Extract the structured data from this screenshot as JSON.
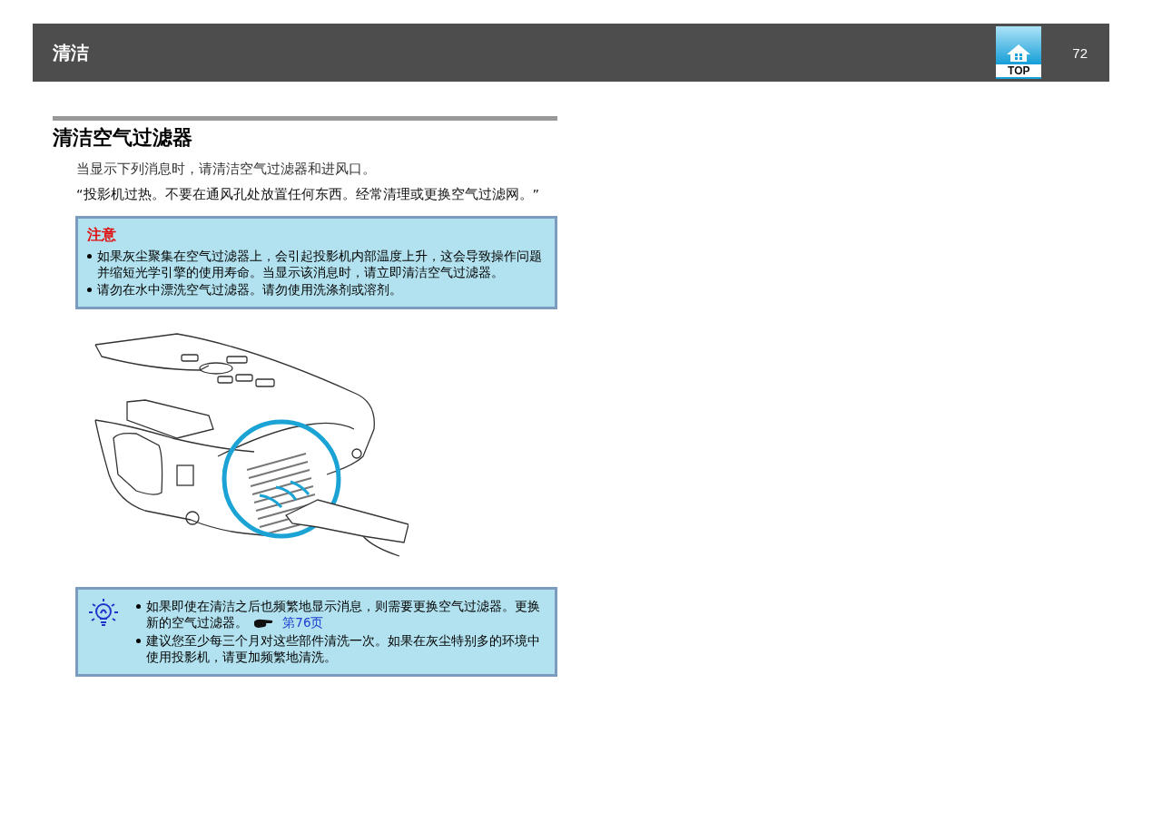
{
  "header": {
    "title": "清洁",
    "top_button": "TOP",
    "page_number": "72"
  },
  "section": {
    "title": "清洁空气过滤器",
    "paragraphs": [
      "当显示下列消息时，请清洁空气过滤器和进风口。",
      "“投影机过热。不要在通风孔处放置任何东西。经常清理或更换空气过滤网。”"
    ],
    "caution": {
      "title": "注意",
      "items": [
        "如果灰尘聚集在空气过滤器上，会引起投影机内部温度上升，这会导致操作问题并缩短光学引擎的使用寿命。当显示该消息时，请立即清洁空气过滤器。",
        "请勿在水中漂洗空气过滤器。请勿使用洗涤剂或溶剂。"
      ]
    },
    "tip": {
      "items": [
        {
          "text": "如果即使在清洁之后也频繁地显示消息，则需要更换空气过滤器。更换新的空气过滤器。",
          "link": "第76页"
        },
        {
          "text": "建议您至少每三个月对这些部件清洗一次。如果在灰尘特别多的环境中使用投影机，请更加频繁地清洗。"
        }
      ]
    }
  }
}
